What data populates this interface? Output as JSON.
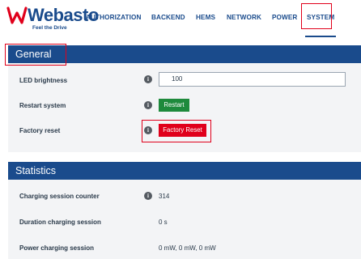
{
  "brand": {
    "name": "Webasto",
    "tagline": "Feel the Drive",
    "color": "#1a4b8c"
  },
  "nav": {
    "items": [
      {
        "label": "AUTHORIZATION"
      },
      {
        "label": "BACKEND"
      },
      {
        "label": "HEMS"
      },
      {
        "label": "NETWORK"
      },
      {
        "label": "POWER"
      },
      {
        "label": "SYSTEM",
        "active": true
      }
    ]
  },
  "general": {
    "title": "General",
    "led_brightness": {
      "label": "LED brightness",
      "value": "100"
    },
    "restart": {
      "label": "Restart system",
      "button": "Restart"
    },
    "factory_reset": {
      "label": "Factory reset",
      "button": "Factory Reset"
    }
  },
  "statistics": {
    "title": "Statistics",
    "session_counter": {
      "label": "Charging session counter",
      "value": "314"
    },
    "duration": {
      "label": "Duration charging session",
      "value": "0 s"
    },
    "power": {
      "label": "Power charging session",
      "value": "0 mW, 0 mW, 0 mW"
    }
  },
  "colors": {
    "header_blue": "#1a4b8c",
    "restart_green": "#1e8a3c",
    "reset_red": "#e0001b",
    "highlight_red": "#e0001b"
  },
  "icons": {
    "info": "info-icon",
    "logo": "webasto-logo-icon"
  }
}
